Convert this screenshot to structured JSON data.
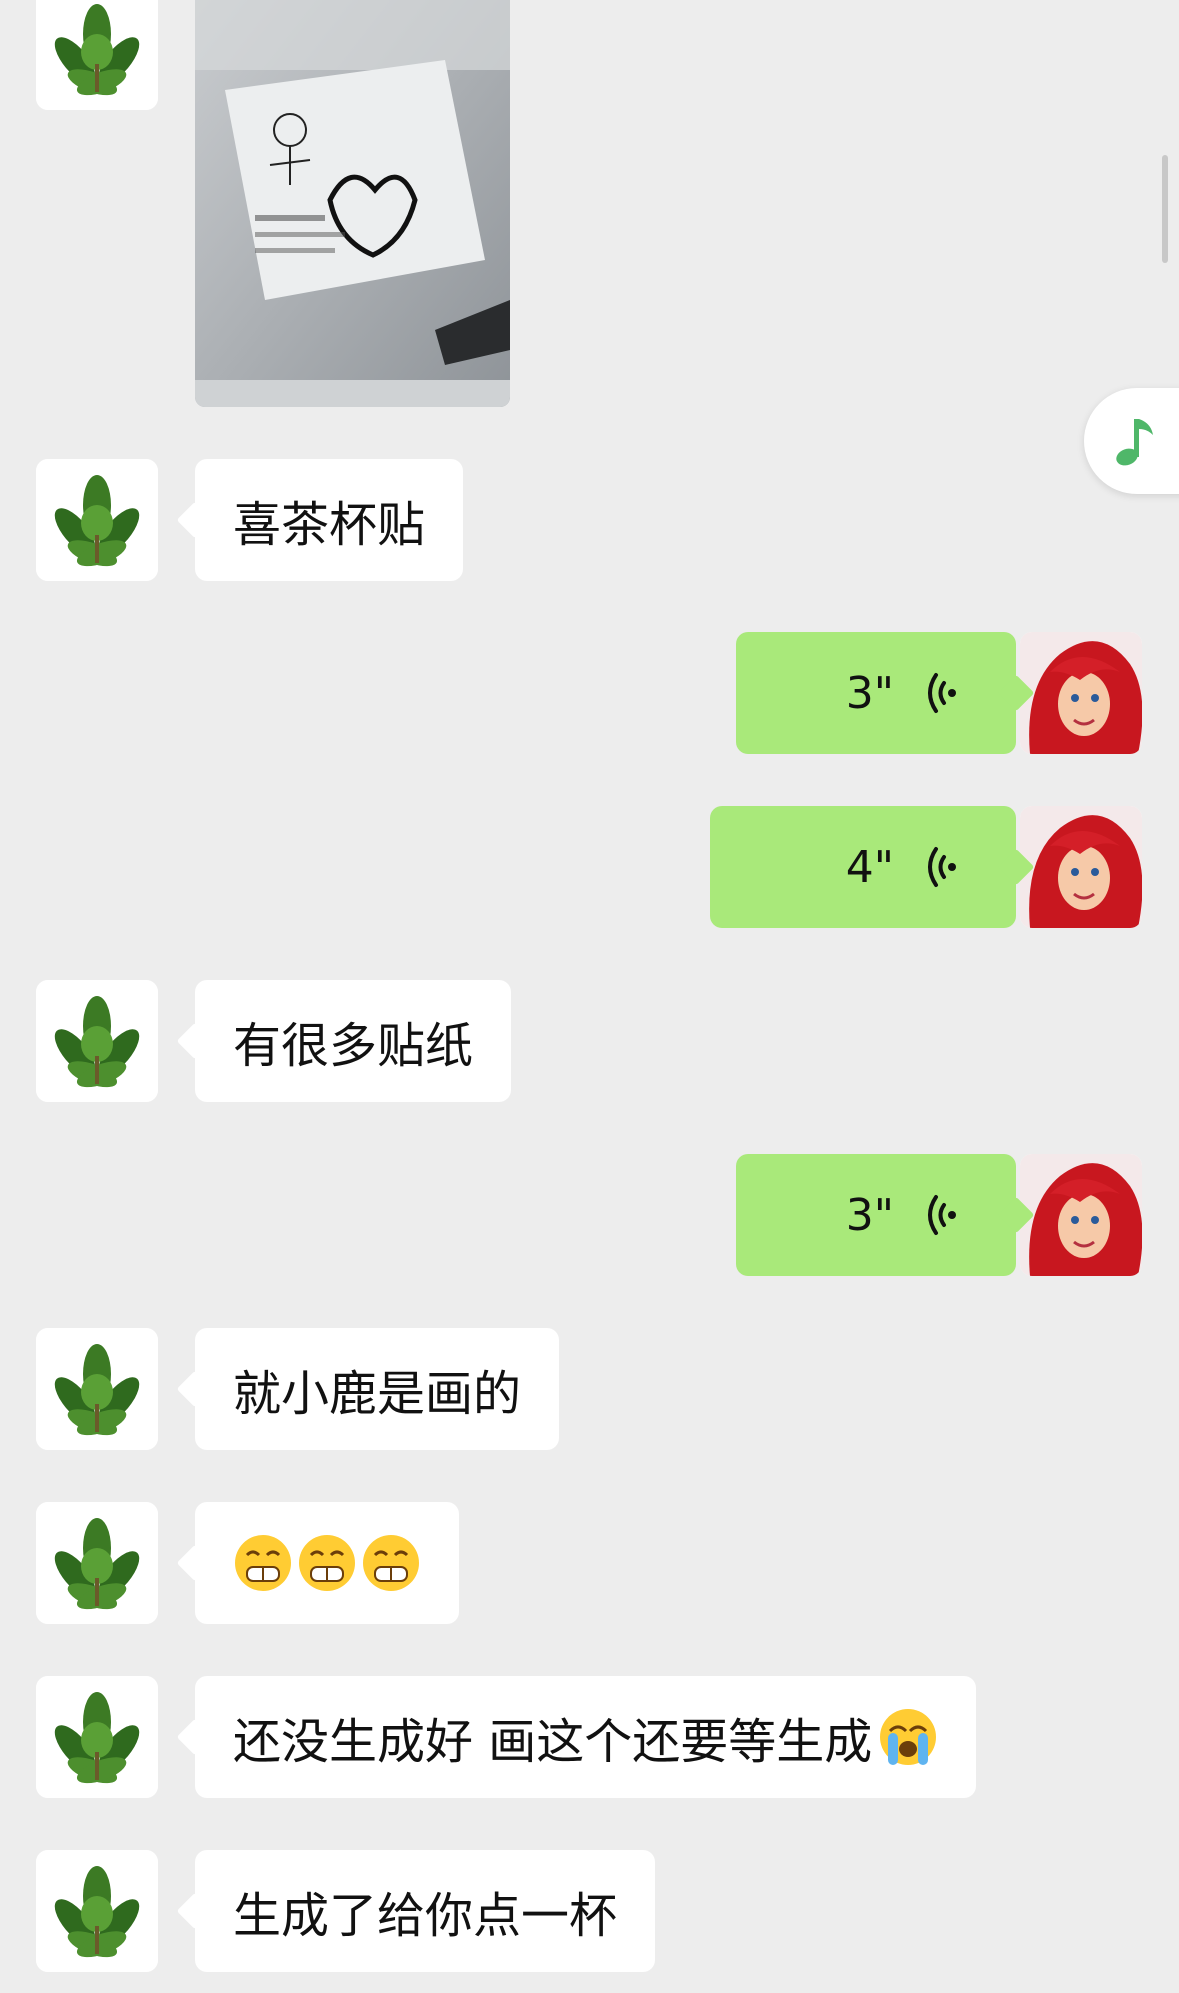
{
  "colors": {
    "background": "#ededed",
    "incoming_bubble": "#ffffff",
    "outgoing_bubble": "#a9e97a",
    "music_accent": "#4fb769"
  },
  "floating": {
    "icon": "music-note-icon"
  },
  "messages": [
    {
      "type": "image",
      "side": "left",
      "avatar": "leaf-avatar"
    },
    {
      "type": "text",
      "side": "left",
      "text": "喜茶杯贴"
    },
    {
      "type": "voice",
      "side": "right",
      "duration": "3\""
    },
    {
      "type": "voice",
      "side": "right",
      "duration": "4\""
    },
    {
      "type": "text",
      "side": "left",
      "text": "有很多贴纸"
    },
    {
      "type": "voice",
      "side": "right",
      "duration": "3\""
    },
    {
      "type": "text",
      "side": "left",
      "text": "就小鹿是画的"
    },
    {
      "type": "emoji",
      "side": "left",
      "emojis": [
        "grin-emoji",
        "grin-emoji",
        "grin-emoji"
      ]
    },
    {
      "type": "text",
      "side": "left",
      "text": "还没生成好 画这个还要等生成",
      "trailing_emoji": "loudly-crying-emoji"
    },
    {
      "type": "text",
      "side": "left",
      "text": "生成了给你点一杯"
    }
  ]
}
